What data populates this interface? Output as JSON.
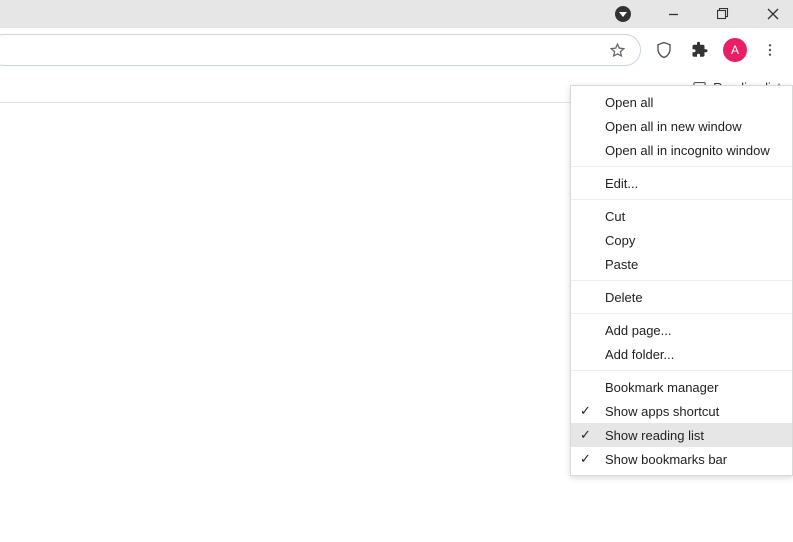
{
  "titlebar": {
    "caret_icon": "account-caret",
    "minimize_icon": "minimize",
    "maximize_icon": "restore",
    "close_icon": "close"
  },
  "toolbar": {
    "star_icon": "star",
    "shield_icon": "vault",
    "extensions_icon": "extensions",
    "avatar_letter": "A",
    "menu_icon": "more-vertical"
  },
  "bookmarks_bar": {
    "reading_list_label": "Reading list",
    "reading_list_icon": "reading-list"
  },
  "context_menu": {
    "sections": [
      {
        "items": [
          {
            "label": "Open all",
            "checked": false,
            "highlighted": false
          },
          {
            "label": "Open all in new window",
            "checked": false,
            "highlighted": false
          },
          {
            "label": "Open all in incognito window",
            "checked": false,
            "highlighted": false
          }
        ]
      },
      {
        "items": [
          {
            "label": "Edit...",
            "checked": false,
            "highlighted": false
          }
        ]
      },
      {
        "items": [
          {
            "label": "Cut",
            "checked": false,
            "highlighted": false
          },
          {
            "label": "Copy",
            "checked": false,
            "highlighted": false
          },
          {
            "label": "Paste",
            "checked": false,
            "highlighted": false
          }
        ]
      },
      {
        "items": [
          {
            "label": "Delete",
            "checked": false,
            "highlighted": false
          }
        ]
      },
      {
        "items": [
          {
            "label": "Add page...",
            "checked": false,
            "highlighted": false
          },
          {
            "label": "Add folder...",
            "checked": false,
            "highlighted": false
          }
        ]
      },
      {
        "items": [
          {
            "label": "Bookmark manager",
            "checked": false,
            "highlighted": false
          },
          {
            "label": "Show apps shortcut",
            "checked": true,
            "highlighted": false
          },
          {
            "label": "Show reading list",
            "checked": true,
            "highlighted": true
          },
          {
            "label": "Show bookmarks bar",
            "checked": true,
            "highlighted": false
          }
        ]
      }
    ]
  }
}
